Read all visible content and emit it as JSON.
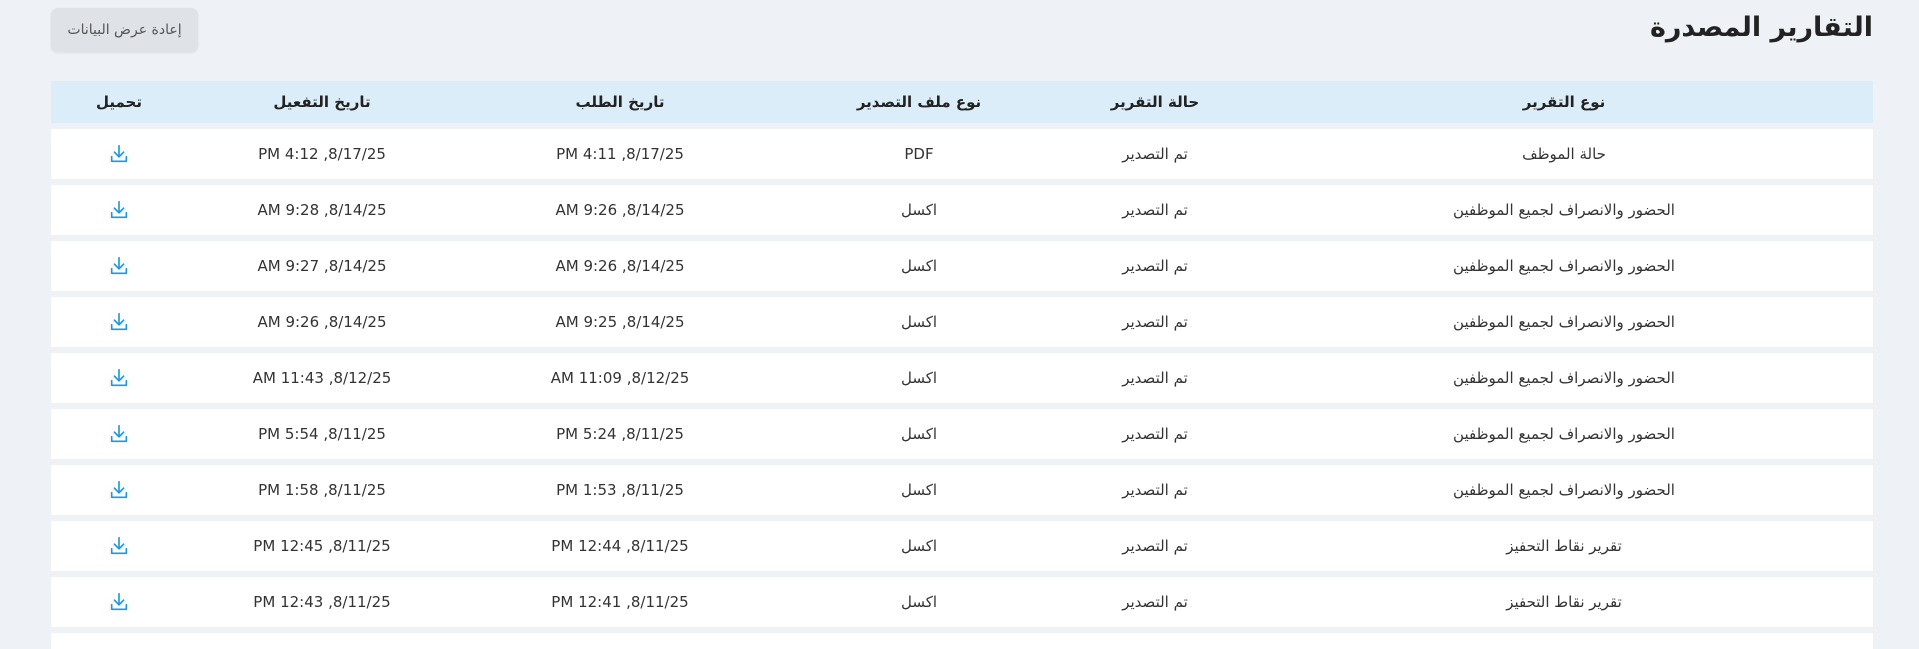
{
  "header": {
    "title": "التقارير المصدرة",
    "reload_label": "إعادة عرض البيانات"
  },
  "table": {
    "columns": [
      "نوع التقرير",
      "حالة التقرير",
      "نوع ملف التصدير",
      "تاريخ الطلب",
      "تاريخ التفعيل",
      "تحميل"
    ],
    "rows": [
      {
        "type": "حالة الموظف",
        "status": "تم التصدير",
        "file": "PDF",
        "requested": "8/17/25, 4:11 PM",
        "activated": "8/17/25, 4:12 PM"
      },
      {
        "type": "الحضور والانصراف لجميع الموظفين",
        "status": "تم التصدير",
        "file": "اكسل",
        "requested": "8/14/25, 9:26 AM",
        "activated": "8/14/25, 9:28 AM"
      },
      {
        "type": "الحضور والانصراف لجميع الموظفين",
        "status": "تم التصدير",
        "file": "اكسل",
        "requested": "8/14/25, 9:26 AM",
        "activated": "8/14/25, 9:27 AM"
      },
      {
        "type": "الحضور والانصراف لجميع الموظفين",
        "status": "تم التصدير",
        "file": "اكسل",
        "requested": "8/14/25, 9:25 AM",
        "activated": "8/14/25, 9:26 AM"
      },
      {
        "type": "الحضور والانصراف لجميع الموظفين",
        "status": "تم التصدير",
        "file": "اكسل",
        "requested": "8/12/25, 11:09 AM",
        "activated": "8/12/25, 11:43 AM"
      },
      {
        "type": "الحضور والانصراف لجميع الموظفين",
        "status": "تم التصدير",
        "file": "اكسل",
        "requested": "8/11/25, 5:24 PM",
        "activated": "8/11/25, 5:54 PM"
      },
      {
        "type": "الحضور والانصراف لجميع الموظفين",
        "status": "تم التصدير",
        "file": "اكسل",
        "requested": "8/11/25, 1:53 PM",
        "activated": "8/11/25, 1:58 PM"
      },
      {
        "type": "تقرير نقاط التحفيز",
        "status": "تم التصدير",
        "file": "اكسل",
        "requested": "8/11/25, 12:44 PM",
        "activated": "8/11/25, 12:45 PM"
      },
      {
        "type": "تقرير نقاط التحفيز",
        "status": "تم التصدير",
        "file": "اكسل",
        "requested": "8/11/25, 12:41 PM",
        "activated": "8/11/25, 12:43 PM"
      }
    ]
  },
  "colors": {
    "accent": "#1a9ad6",
    "header_bg": "#dbedf8",
    "page_bg": "#eef2f7"
  },
  "icons": {
    "download": "download-icon"
  }
}
